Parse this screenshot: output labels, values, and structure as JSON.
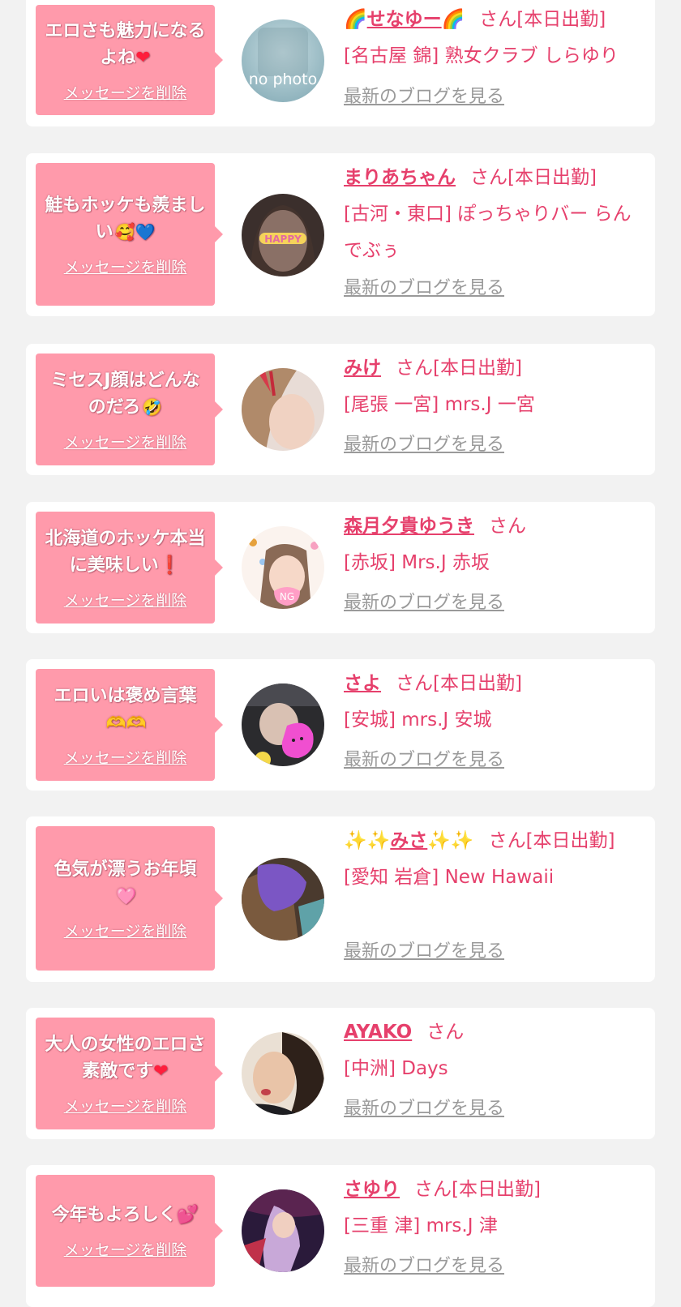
{
  "delete_label": "メッセージを削除",
  "blog_label": "最新のブログを見る",
  "cards": [
    {
      "message": "エロさも魅力になるよね",
      "emoji": "❤",
      "name": "せなゆー",
      "suffix": "さん[本日出勤]",
      "shop": "[名古屋 錦] 熟女クラブ しらゆり",
      "avatar_text": "no photo",
      "avatar_icon": "no-photo-placeholder"
    },
    {
      "message": "鮭もホッケも羨ましい",
      "emoji": "🥰💙",
      "name": "まりあちゃん",
      "suffix": "さん[本日出勤]",
      "shop": "[古河・東口] ぽっちゃりバー らんでぶぅ",
      "avatar_text": "HAPPY"
    },
    {
      "message": "ミセスJ顔はどんなのだろ",
      "emoji": "🤣",
      "name": "みけ",
      "suffix": "さん[本日出勤]",
      "shop": "[尾張 一宮] mrs.J 一宮"
    },
    {
      "message": "北海道のホッケ本当に美味しい",
      "emoji": "❗",
      "name": "森月夕貴ゆうき",
      "suffix": "さん",
      "shop": "[赤坂] Mrs.J 赤坂",
      "avatar_text": "NG"
    },
    {
      "message": "エロいは褒め言葉",
      "emoji": "🫶🫶",
      "name": "さよ",
      "suffix": "さん[本日出勤]",
      "shop": "[安城] mrs.J 安城"
    },
    {
      "message": "色気が漂うお年頃",
      "emoji": "🩷",
      "name": "みさ",
      "suffix": "さん[本日出勤]",
      "shop": "[愛知 岩倉] New Hawaii"
    },
    {
      "message": "大人の女性のエロさ素敵です",
      "emoji": "❤",
      "name": "AYAKO",
      "suffix": "さん",
      "shop": "[中洲] Days"
    },
    {
      "message": "今年もよろしく",
      "emoji": "💕",
      "name": "さゆり",
      "suffix": "さん[本日出勤]",
      "shop": "[三重 津] mrs.J 津"
    }
  ],
  "colors": {
    "accent": "#e6406c",
    "bubble": "#ff9aab",
    "link_gray": "#9a9a9a",
    "background": "#f2f2f2"
  }
}
